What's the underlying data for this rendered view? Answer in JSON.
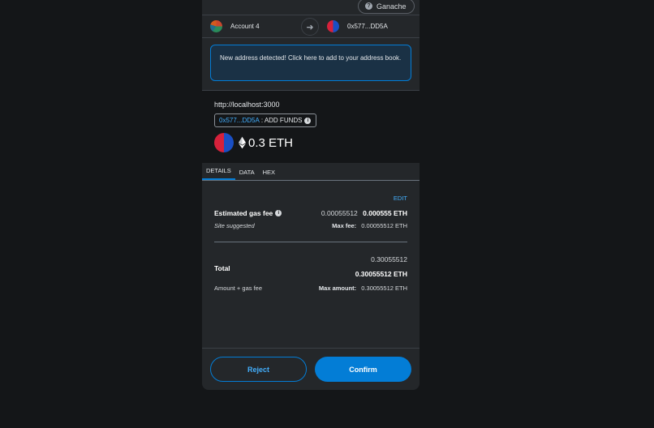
{
  "network": {
    "label": "Ganache",
    "icon": "question-icon"
  },
  "accounts": {
    "from_name": "Account 4",
    "to_address": "0x577...DD5A",
    "arrow_icon": "arrow-right-icon"
  },
  "banner": {
    "text": "New address detected! Click here to add to your address book."
  },
  "summary": {
    "origin": "http://localhost:3000",
    "address_link": "0x577...DD5A",
    "add_funds_label": ": ADD FUNDS",
    "amount": "0.3 ETH"
  },
  "tabs": [
    {
      "label": "DETAILS",
      "active": true
    },
    {
      "label": "DATA",
      "active": false
    },
    {
      "label": "HEX",
      "active": false
    }
  ],
  "details": {
    "edit_label": "EDIT",
    "gas_label": "Estimated gas fee",
    "gas_secondary": "0.00055512",
    "gas_primary": "0.000555 ETH",
    "site_suggested": "Site suggested",
    "max_fee_label": "Max fee:",
    "max_fee_value": "0.00055512 ETH",
    "total_secondary": "0.30055512",
    "total_label": "Total",
    "total_primary": "0.30055512 ETH",
    "amount_gas_label": "Amount + gas fee",
    "max_amount_label": "Max amount:",
    "max_amount_value": "0.30055512 ETH"
  },
  "footer": {
    "reject_label": "Reject",
    "confirm_label": "Confirm"
  },
  "colors": {
    "accent": "#037dd6",
    "link": "#43aefc",
    "background": "#141618",
    "panel": "#24272a"
  }
}
